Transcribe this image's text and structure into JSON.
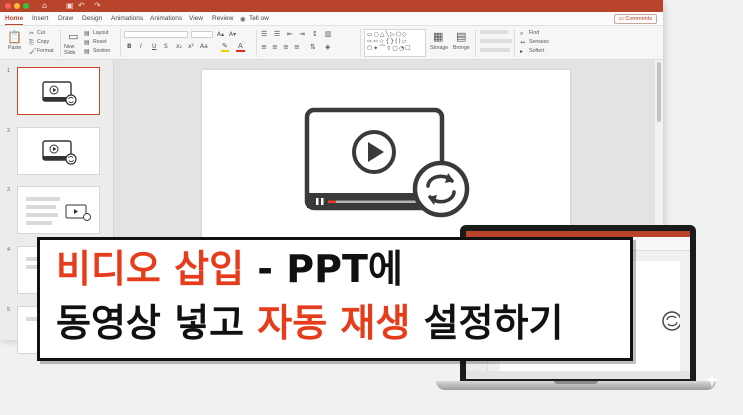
{
  "window": {
    "title_icons": [
      "home-icon",
      "save-icon",
      "undo-icon",
      "redo-icon"
    ],
    "traffic_lights": [
      "#fe5f57",
      "#febc2e",
      "#28c840"
    ]
  },
  "tabs": [
    {
      "label": "Home",
      "active": true
    },
    {
      "label": "Insert"
    },
    {
      "label": "Draw"
    },
    {
      "label": "Design"
    },
    {
      "label": "Animations"
    },
    {
      "label": "Animations"
    },
    {
      "label": "View"
    },
    {
      "label": "Review"
    },
    {
      "label": "Tell ow"
    }
  ],
  "comments_label": "Comments",
  "ribbon": {
    "paste": "Paste",
    "cut": "Cut",
    "copy": "Copy",
    "format": "Format",
    "new_slide": "New Slide",
    "layout": "Layout",
    "reset": "Reset",
    "section": "Sestion",
    "storage": "Storage",
    "bronge": "Bronge",
    "find": "Find",
    "sensess": "Sensess",
    "softert": "Softert"
  },
  "thumbnails": [
    {
      "number": "1",
      "selected": true
    },
    {
      "number": "2"
    },
    {
      "number": "3"
    },
    {
      "number": "4"
    },
    {
      "number": "5"
    }
  ],
  "banner": {
    "line1_red": "비디오 삽입",
    "line1_black": " - PPT에",
    "line2_a": "동영상 넣고 ",
    "line2_red1": "자동",
    "line2_sp": " ",
    "line2_red2": "재생",
    "line2_b": " 설정하기"
  },
  "colors": {
    "accent": "#b8442b",
    "banner_red": "#e53d1c"
  }
}
